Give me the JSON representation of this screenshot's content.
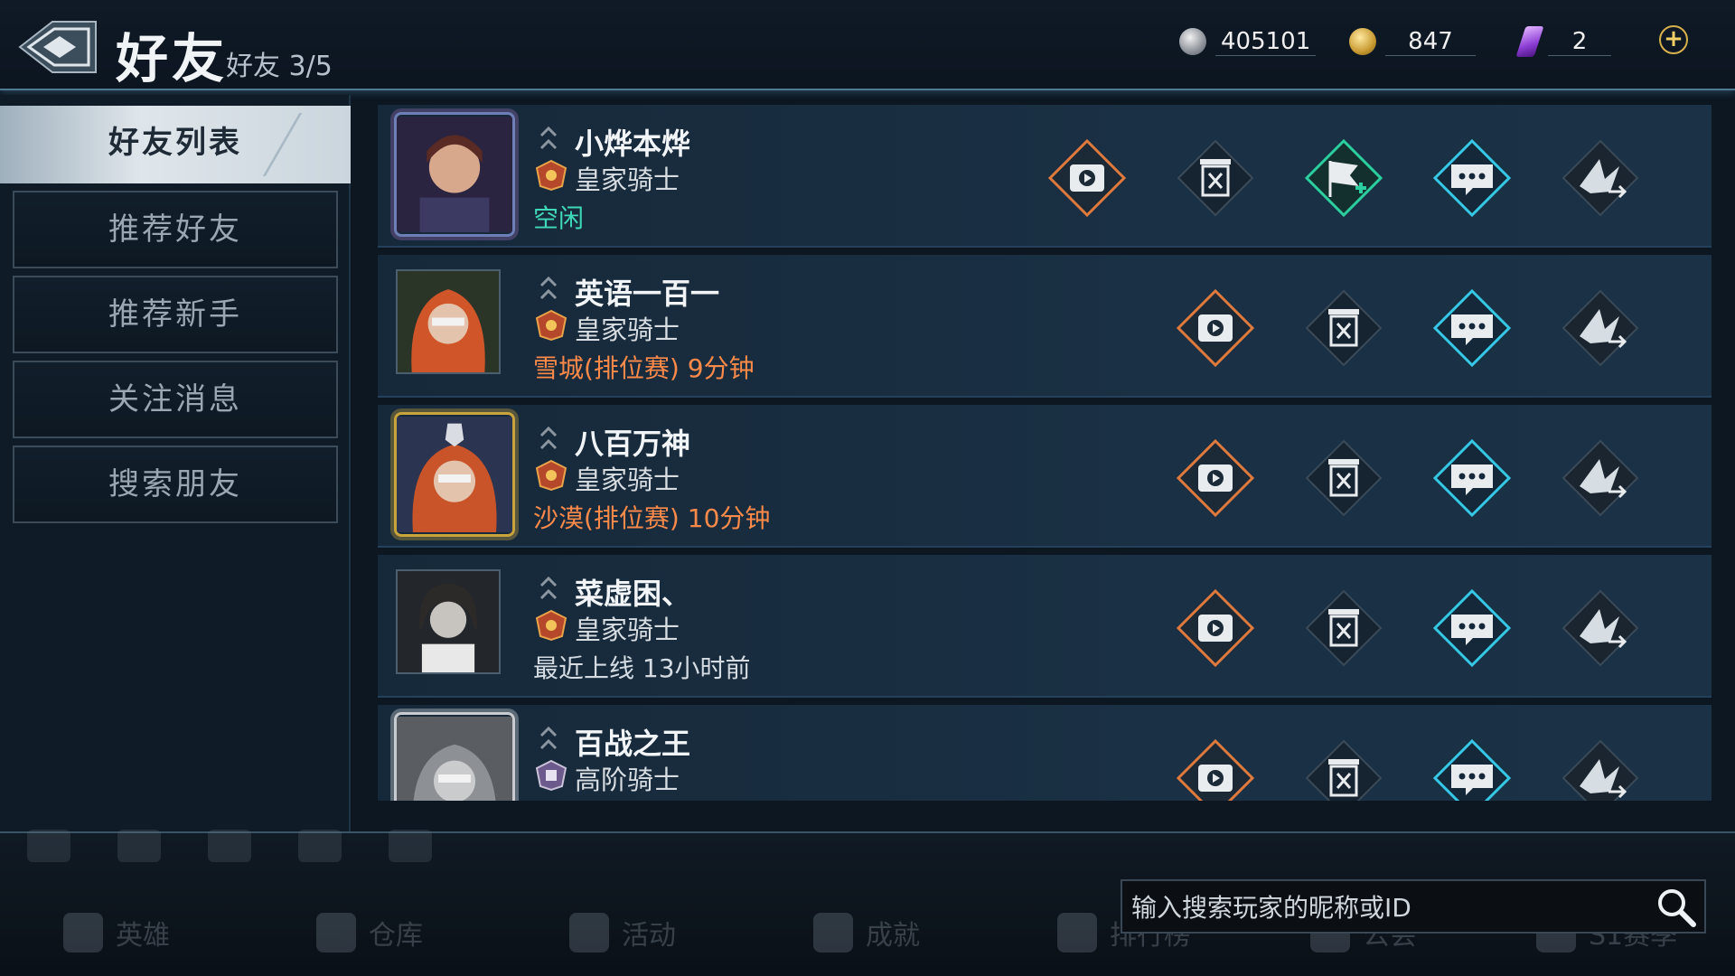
{
  "header": {
    "title": "好友",
    "subtitle": "好友 3/5",
    "currencies": [
      {
        "icon": "silver-coin-icon",
        "amount": "405101"
      },
      {
        "icon": "gold-coin-icon",
        "amount": "847"
      },
      {
        "icon": "purple-gem-icon",
        "amount": "2"
      }
    ]
  },
  "sidebar": {
    "items": [
      {
        "label": "好友列表",
        "active": true
      },
      {
        "label": "推荐好友"
      },
      {
        "label": "推荐新手"
      },
      {
        "label": "关注消息"
      },
      {
        "label": "搜索朋友"
      }
    ]
  },
  "friends": [
    {
      "name": "小烨本烨",
      "title": "皇家骑士",
      "status": "空闲",
      "status_type": "idle",
      "actions": [
        "watch",
        "delete",
        "invite",
        "chat",
        "gift"
      ]
    },
    {
      "name": "英语一百一",
      "title": "皇家骑士",
      "status": "雪城(排位赛) 9分钟",
      "status_type": "in-game",
      "actions": [
        "watch",
        "delete",
        "chat",
        "gift"
      ]
    },
    {
      "name": "八百万神",
      "title": "皇家骑士",
      "status": "沙漠(排位赛) 10分钟",
      "status_type": "in-game",
      "actions": [
        "watch",
        "delete",
        "chat",
        "gift"
      ]
    },
    {
      "name": "菜虚困、",
      "title": "皇家骑士",
      "status": "最近上线 13小时前",
      "status_type": "offline",
      "actions": [
        "watch",
        "delete",
        "chat",
        "gift"
      ]
    },
    {
      "name": "百战之王",
      "title": "高阶骑士",
      "status": "",
      "status_type": "offline",
      "actions": [
        "watch",
        "delete",
        "chat",
        "gift"
      ]
    }
  ],
  "bottom": {
    "nav": [
      "英雄",
      "仓库",
      "活动",
      "成就",
      "排行榜",
      "公会",
      "S1赛季"
    ],
    "search_placeholder": "输入搜索玩家的昵称或ID"
  },
  "colors": {
    "status_idle": "#3fd9b8",
    "status_in_game": "#ff8a4a",
    "accent_watch": "#e07a3c",
    "accent_chat": "#35c9e6",
    "accent_invite": "#2ccf9e"
  }
}
